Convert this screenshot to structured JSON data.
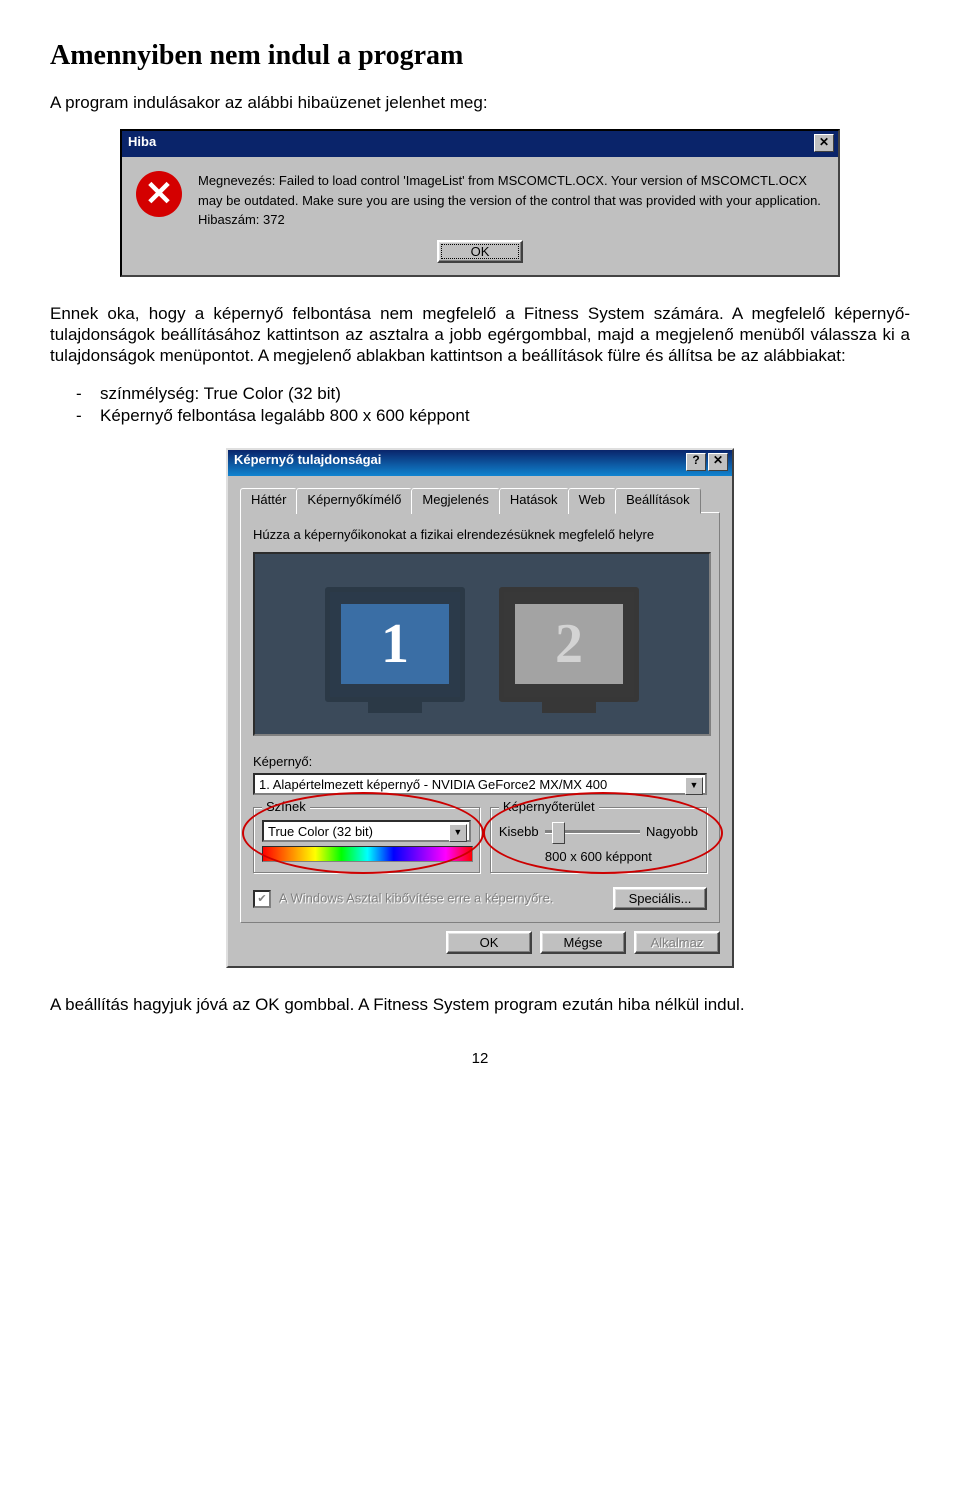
{
  "doc": {
    "heading": "Amennyiben nem indul a program",
    "intro": "A program indulásakor az alábbi hibaüzenet jelenhet meg:",
    "para1": "Ennek oka, hogy a képernyő felbontása nem megfelelő a Fitness System számára. A megfelelő képernyő-tulajdonságok beállításához kattintson az asztalra a jobb egérgombbal, majd a megjelenő menüből válassza ki a tulajdonságok menüpontot. A megjelenő ablakban kattintson a beállítások fülre és állítsa be az alábbiakat:",
    "bullets": [
      "színmélység: True Color (32 bit)",
      "Képernyő felbontása legalább 800 x 600 képpont"
    ],
    "para2": "A beállítás hagyjuk jóvá az OK gombbal. A Fitness System program ezután hiba nélkül indul.",
    "page": "12"
  },
  "hiba": {
    "title": "Hiba",
    "icon": "✕",
    "line1": "Megnevezés: Failed to load control 'ImageList' from MSCOMCTL.OCX.  Your version of MSCOMCTL.OCX may be outdated.  Make sure you are using the version of the control that was provided with your application.",
    "line2": "Hibaszám: 372",
    "ok": "OK"
  },
  "dprops": {
    "title": "Képernyő tulajdonságai",
    "tabs": [
      "Háttér",
      "Képernyőkímélő",
      "Megjelenés",
      "Hatások",
      "Web",
      "Beállítások"
    ],
    "instr": "Húzza a képernyőikonokat a fizikai elrendezésüknek megfelelő helyre",
    "mon1": "1",
    "mon2": "2",
    "screen_label": "Képernyő:",
    "screen_value": "1. Alapértelmezett képernyő - NVIDIA GeForce2 MX/MX 400",
    "colors_label": "Színek",
    "colors_value": "True Color (32 bit)",
    "area_label": "Képernyőterület",
    "area_less": "Kisebb",
    "area_more": "Nagyobb",
    "area_value": "800 x 600 képpont",
    "extend": "A Windows Asztal kibővítése erre a képernyőre.",
    "advanced": "Speciális...",
    "ok": "OK",
    "cancel": "Mégse",
    "apply": "Alkalmaz"
  }
}
